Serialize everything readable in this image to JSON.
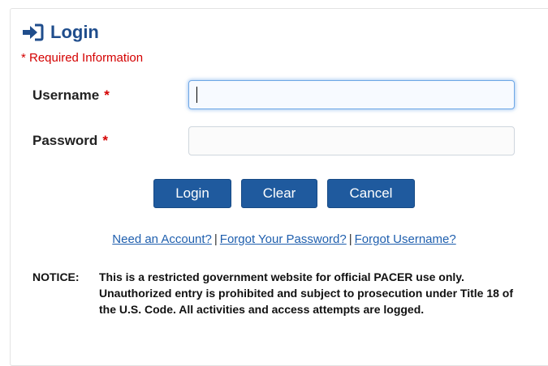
{
  "login_panel": {
    "title": "Login",
    "title_icon": "sign-in-icon",
    "required_note": "* Required Information",
    "fields": {
      "username": {
        "label": "Username",
        "required_marker": "*",
        "value": "",
        "placeholder": ""
      },
      "password": {
        "label": "Password",
        "required_marker": "*",
        "value": "",
        "placeholder": ""
      }
    },
    "buttons": {
      "login": "Login",
      "clear": "Clear",
      "cancel": "Cancel"
    },
    "links": {
      "need_account": "Need an Account?",
      "separator": "|",
      "forgot_password": "Forgot Your Password?",
      "forgot_username": "Forgot Username?"
    },
    "notice": {
      "label": "NOTICE:",
      "text": "This is a restricted government website for official PACER use only. Unauthorized entry is prohibited and subject to prosecution under Title 18 of the U.S. Code. All activities and access attempts are logged."
    }
  },
  "colors": {
    "title": "#1f4d8c",
    "required": "#d40000",
    "button": "#1f5a9e",
    "link": "#1f5fae",
    "focus_glow": "#6ea7e6"
  }
}
